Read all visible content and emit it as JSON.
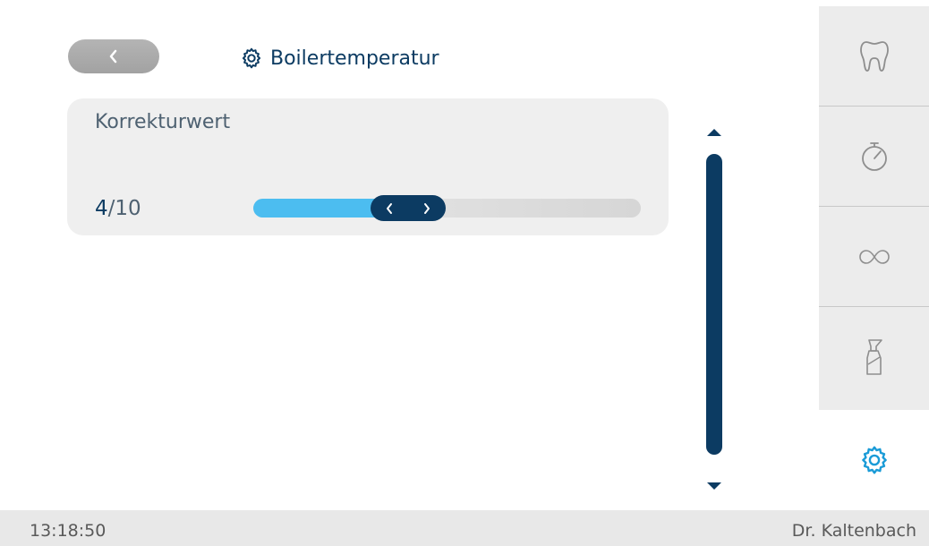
{
  "header": {
    "title": "Boilertemperatur",
    "title_icon": "gear-icon",
    "back_icon": "chevron-left-icon"
  },
  "setting": {
    "label": "Korrekturwert",
    "current": "4",
    "max": "/10",
    "value_fraction": 0.4
  },
  "sidebar": {
    "items": [
      {
        "icon": "tooth-icon"
      },
      {
        "icon": "stopwatch-icon"
      },
      {
        "icon": "infinity-icon"
      },
      {
        "icon": "spray-bottle-icon"
      }
    ],
    "active_icon": "gear-icon"
  },
  "status": {
    "time": "13:18:50",
    "user": "Dr. Kaltenbach"
  },
  "colors": {
    "accent": "#0c3b62",
    "slider_fill": "#4cbdf0",
    "active_icon": "#1a9bd7"
  }
}
